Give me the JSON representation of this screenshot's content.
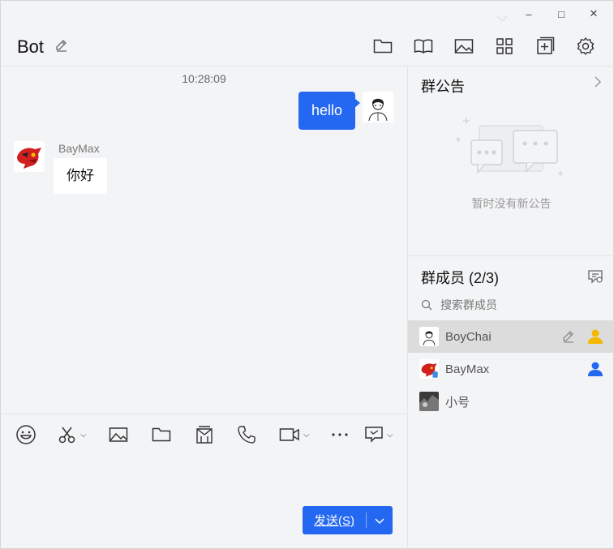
{
  "header": {
    "title": "Bot",
    "tools": [
      {
        "icon": "folder-icon"
      },
      {
        "icon": "book-icon"
      },
      {
        "icon": "image-icon"
      },
      {
        "icon": "apps-grid-icon"
      },
      {
        "icon": "add-square-icon"
      },
      {
        "icon": "gear-icon"
      }
    ]
  },
  "window_controls": {
    "minimize": "–",
    "maximize": "□",
    "close": "✕"
  },
  "chat": {
    "timestamp": "10:28:09",
    "messages": [
      {
        "from": "me",
        "text": "hello"
      },
      {
        "from": "BayMax",
        "sender": "BayMax",
        "text": "你好"
      }
    ]
  },
  "input_toolbar": [
    {
      "icon": "emoji-icon",
      "dropdown": false
    },
    {
      "icon": "scissors-icon",
      "dropdown": true
    },
    {
      "icon": "image-icon",
      "dropdown": false
    },
    {
      "icon": "folder-icon",
      "dropdown": false
    },
    {
      "icon": "red-packet-icon",
      "dropdown": false
    },
    {
      "icon": "phone-icon",
      "dropdown": false
    },
    {
      "icon": "video-icon",
      "dropdown": true
    },
    {
      "icon": "more-icon",
      "dropdown": false
    },
    {
      "icon": "chat-bubble-icon",
      "dropdown": true
    }
  ],
  "send": {
    "label": "发送(S)"
  },
  "announcement": {
    "title": "群公告",
    "empty_text": "暂时没有新公告"
  },
  "members": {
    "title": "群成员 (2/3)",
    "search_placeholder": "搜索群成员",
    "list": [
      {
        "name": "BoyChai",
        "selected": true,
        "role_color": "#f5b800"
      },
      {
        "name": "BayMax",
        "selected": false,
        "role_color": "#2468f2"
      },
      {
        "name": "小号",
        "selected": false,
        "role_color": ""
      }
    ]
  },
  "colors": {
    "accent": "#2468f2",
    "owner": "#f5b800",
    "background": "#f3f4f6"
  }
}
